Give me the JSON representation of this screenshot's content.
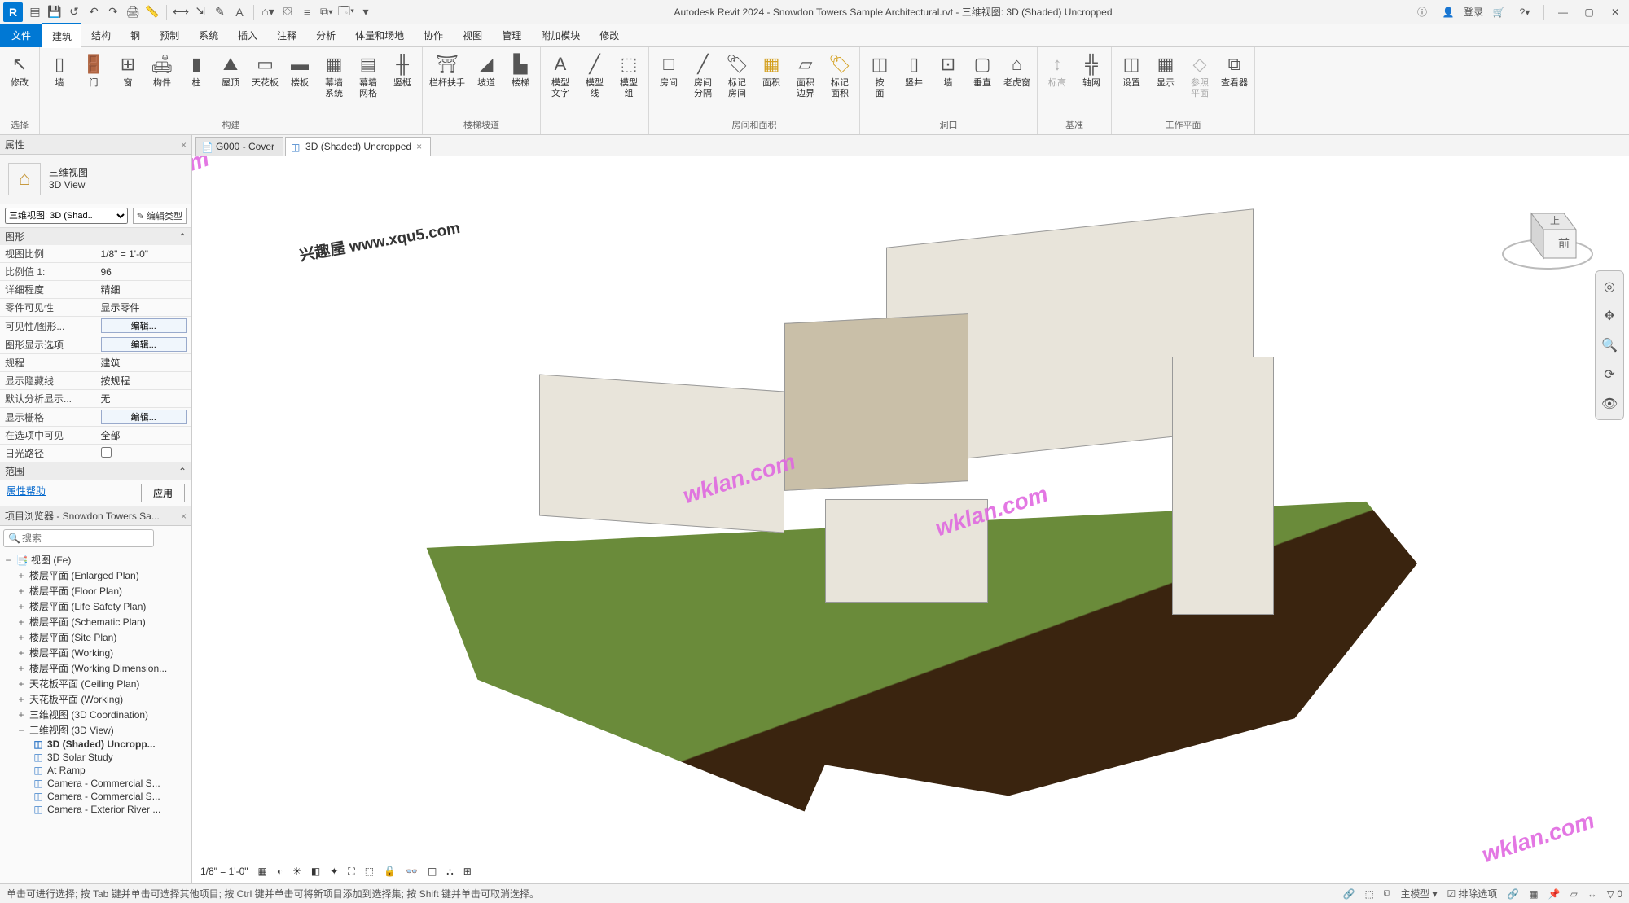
{
  "app": {
    "title": "Autodesk Revit 2024 - Snowdon Towers Sample Architectural.rvt - 三维视图: 3D (Shaded) Uncropped",
    "login": "登录"
  },
  "menus": {
    "file": "文件",
    "arch": "建筑",
    "struct": "结构",
    "steel": "钢",
    "precast": "预制",
    "systems": "系统",
    "insert": "插入",
    "annotate": "注释",
    "analyze": "分析",
    "massing": "体量和场地",
    "collab": "协作",
    "view": "视图",
    "manage": "管理",
    "addins": "附加模块",
    "modify": "修改"
  },
  "ribbon": {
    "modify": "修改",
    "select": "选择",
    "wall": "墙",
    "door": "门",
    "window": "窗",
    "component": "构件",
    "column": "柱",
    "roof": "屋顶",
    "ceiling": "天花板",
    "floor": "楼板",
    "curtain_system": "幕墙\n系统",
    "curtain_grid": "幕墙\n网格",
    "mullion": "竖梃",
    "build": "构建",
    "railing": "栏杆扶手",
    "ramp": "坡道",
    "stair": "楼梯",
    "circulation": "楼梯坡道",
    "model_text": "模型\n文字",
    "model_line": "模型\n线",
    "model_group": "模型\n组",
    "room": "房间",
    "room_sep": "房间\n分隔",
    "tag_room": "标记\n房间",
    "area": "面积",
    "area_bound": "面积\n边界",
    "tag_area": "标记\n面积",
    "room_area": "房间和面积",
    "by_face": "按\n面",
    "wall_open": "墙",
    "vertical": "垂直",
    "dormer": "老虎窗",
    "opening": "洞口",
    "datum_level": "标高",
    "datum_grid": "轴网",
    "datum": "基准",
    "set": "设置",
    "show": "显示",
    "ref_plane": "参照\n平面",
    "viewer": "查看器",
    "work_plane": "工作平面"
  },
  "tabs": {
    "t1": "G000 - Cover",
    "t2": "3D (Shaded) Uncropped"
  },
  "properties": {
    "header": "属性",
    "type_name1": "三维视图",
    "type_name2": "3D View",
    "selector": "三维视图: 3D (Shad..",
    "edit_type": "编辑类型",
    "graphics": "图形",
    "view_scale_lbl": "视图比例",
    "view_scale_val": "1/8\" = 1'-0\"",
    "scale_val_lbl": "比例值 1:",
    "scale_val_val": "96",
    "detail_lbl": "详细程度",
    "detail_val": "精细",
    "parts_vis_lbl": "零件可见性",
    "parts_vis_val": "显示零件",
    "vg_lbl": "可见性/图形...",
    "vg_val": "编辑...",
    "disp_opt_lbl": "图形显示选项",
    "disp_opt_val": "编辑...",
    "discipline_lbl": "规程",
    "discipline_val": "建筑",
    "hidden_lbl": "显示隐藏线",
    "hidden_val": "按规程",
    "analysis_lbl": "默认分析显示...",
    "analysis_val": "无",
    "show_grids_lbl": "显示栅格",
    "show_grids_val": "编辑...",
    "in_sel_lbl": "在选项中可见",
    "in_sel_val": "全部",
    "sun_path_lbl": "日光路径",
    "extents": "范围",
    "help": "属性帮助",
    "apply": "应用"
  },
  "browser": {
    "header": "项目浏览器 - Snowdon Towers Sa...",
    "search_ph": "搜索",
    "views_root": "视图 (Fe)",
    "nodes": {
      "n1": "楼层平面 (Enlarged Plan)",
      "n2": "楼层平面 (Floor Plan)",
      "n3": "楼层平面 (Life Safety Plan)",
      "n4": "楼层平面 (Schematic Plan)",
      "n5": "楼层平面 (Site Plan)",
      "n6": "楼层平面 (Working)",
      "n7": "楼层平面 (Working Dimension...",
      "n8": "天花板平面 (Ceiling Plan)",
      "n9": "天花板平面 (Working)",
      "n10": "三维视图 (3D Coordination)",
      "n11": "三维视图 (3D View)",
      "l1": "3D (Shaded) Uncropp...",
      "l2": "3D Solar Study",
      "l3": "At Ramp",
      "l4": "Camera - Commercial S...",
      "l5": "Camera - Commercial S...",
      "l6": "Camera - Exterior River ..."
    }
  },
  "viewctrl": {
    "scale": "1/8\" = 1'-0\""
  },
  "viewcube": {
    "top": "上",
    "front": "前"
  },
  "status": {
    "hint": "单击可进行选择; 按 Tab 键并单击可选择其他项目; 按 Ctrl 键并单击可将新项目添加到选择集; 按 Shift 键并单击可取消选择。",
    "model": "主模型",
    "filter": "排除选项"
  },
  "watermarks": {
    "wk": "wklan.com",
    "xq": "兴趣屋 www.xqu5.com"
  }
}
